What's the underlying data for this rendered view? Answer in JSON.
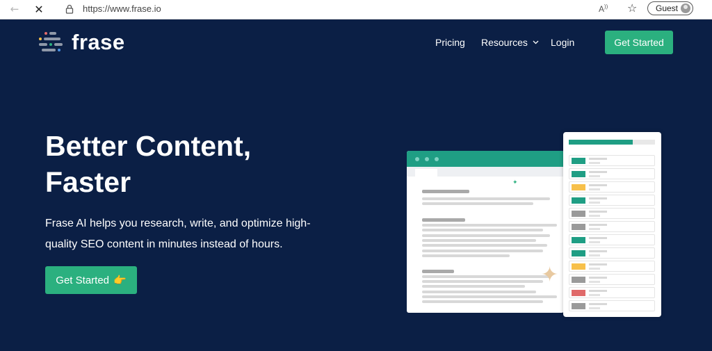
{
  "browser": {
    "url": "https://www.frase.io",
    "guest_label": "Guest",
    "icons": [
      "back-arrow-icon",
      "stop-loading-icon",
      "lock-icon",
      "read-aloud-icon",
      "favorites-icon",
      "avatar-icon"
    ]
  },
  "nav": {
    "logo_text": "frase",
    "items": [
      {
        "label": "Pricing"
      },
      {
        "label": "Resources"
      },
      {
        "label": "Login"
      }
    ],
    "cta_label": "Get Started"
  },
  "hero": {
    "title_line1": "Better Content,",
    "title_line2": "Faster",
    "subtitle": "Frase AI helps you research, write, and optimize high-quality SEO content in minutes instead of hours.",
    "cta_label": "Get Started",
    "cta_emoji": "👉"
  },
  "colors": {
    "background": "#0b1f45",
    "accent_green": "#2bb07f",
    "teal": "#1f9e84",
    "yellow": "#f7c04a",
    "red": "#e06a6a",
    "gray": "#9a9a9a"
  },
  "illustration": {
    "score_rows": [
      "green",
      "green",
      "yellow",
      "green",
      "gray",
      "green",
      "green",
      "green",
      "yellow",
      "gray",
      "red",
      "gray"
    ]
  }
}
